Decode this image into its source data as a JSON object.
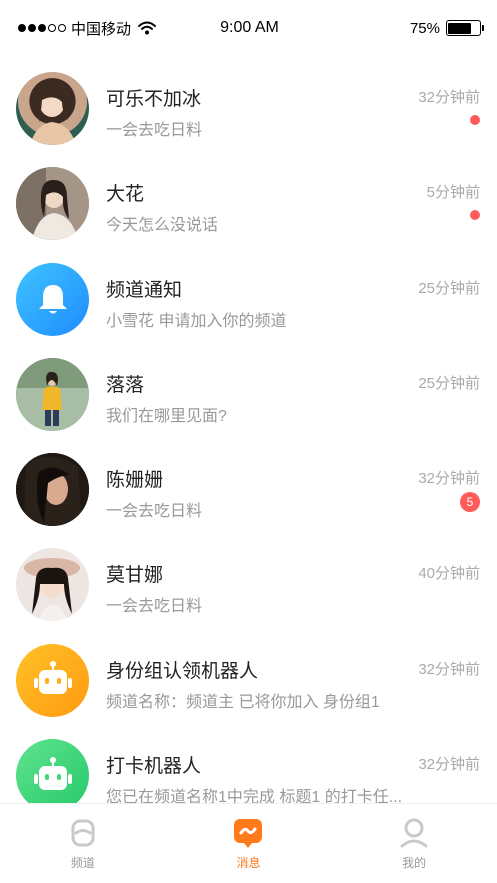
{
  "status_bar": {
    "carrier": "中国移动",
    "time": "9:00 AM",
    "battery": "75%"
  },
  "conversations": [
    {
      "name": "可乐不加冰",
      "message": "一会去吃日料",
      "time": "32分钟前",
      "unread": "dot"
    },
    {
      "name": "大花",
      "message": "今天怎么没说话",
      "time": "5分钟前",
      "unread": "dot"
    },
    {
      "name": "频道通知",
      "message": "小雪花 申请加入你的频道",
      "time": "25分钟前",
      "unread": ""
    },
    {
      "name": "落落",
      "message": "我们在哪里见面?",
      "time": "25分钟前",
      "unread": ""
    },
    {
      "name": "陈姗姗",
      "message": "一会去吃日料",
      "time": "32分钟前",
      "unread": "5"
    },
    {
      "name": "莫甘娜",
      "message": "一会去吃日料",
      "time": "40分钟前",
      "unread": ""
    },
    {
      "name": "身份组认领机器人",
      "message": "频道名称：频道主 已将你加入 身份组1",
      "time": "32分钟前",
      "unread": ""
    },
    {
      "name": "打卡机器人",
      "message": "您已在频道名称1中完成 标题1 的打卡任...",
      "time": "32分钟前",
      "unread": ""
    }
  ],
  "tabs": [
    {
      "label": "频道",
      "icon": "channel-icon",
      "active": false
    },
    {
      "label": "消息",
      "icon": "message-icon",
      "active": true
    },
    {
      "label": "我的",
      "icon": "profile-icon",
      "active": false
    }
  ],
  "colors": {
    "accent": "#ff7a1a",
    "badge": "#ff5b5b",
    "notify_blue": "#2aa6ff",
    "robot_orange": "#ffae1a",
    "robot_green": "#3fd87a"
  }
}
